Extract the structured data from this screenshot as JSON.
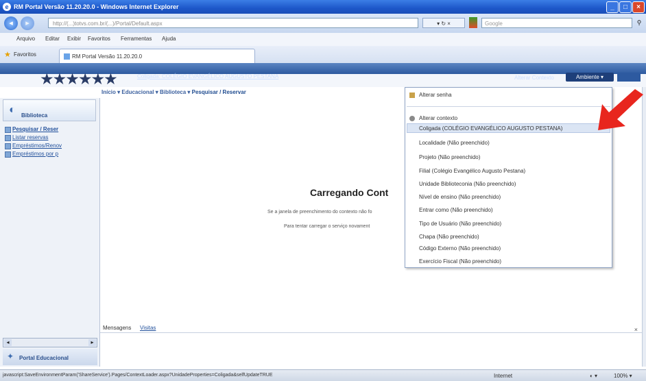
{
  "window": {
    "title": "RM Portal Versão 11.20.20.0 - Windows Internet Explorer",
    "min": "_",
    "max": "□",
    "close": "×"
  },
  "address": {
    "url": "http://(...)totvs.com.br/(...)/Portal/Default.aspx",
    "controls": "▾ ↻ ×",
    "search_placeholder": "Google",
    "search_icon": "search-icon"
  },
  "menu": {
    "items": [
      "Arquivo",
      "Editar",
      "Exibir",
      "Favoritos",
      "Ferramentas",
      "Ajuda"
    ]
  },
  "favorites": {
    "label": "Favoritos",
    "tab_title": "RM Portal Versão 11.20.20.0"
  },
  "portal": {
    "stars": "★★★★★★",
    "context_link": "Coligada: COLÉGIO EVANGÉLICO AUGUSTO PESTANA",
    "user_token": "Alterar Contexto",
    "ambiente_button": "Ambiente ▾",
    "breadcrumb_prefix": "Início ▾  Educacional ▾  Biblioteca ▾ ",
    "breadcrumb_current": "Pesquisar / Reservar"
  },
  "sidebar": {
    "title": "Biblioteca",
    "items": [
      {
        "label": "Pesquisar / Reser",
        "icon": "search-icon"
      },
      {
        "label": "Listar reservas",
        "icon": "list-icon"
      },
      {
        "label": "Empréstimos/Renov",
        "icon": "book-icon"
      },
      {
        "label": "Empréstimos por p",
        "icon": "book-icon"
      }
    ],
    "scroll_left": "◂",
    "scroll_right": "▸",
    "footer": "Portal Educacional"
  },
  "main": {
    "loading_title": "Carregando Cont",
    "loading_line1": "Se a janela de preenchimento do contexto não fo",
    "loading_line2": "Para tentar carregar o serviço novament"
  },
  "messages": {
    "tab1": "Mensagens",
    "tab2": "Visitas",
    "close": "×"
  },
  "dropdown": {
    "change_password": "Alterar senha",
    "change_context": "Alterar contexto",
    "items": [
      "Coligada (COLÉGIO EVANGÉLICO AUGUSTO PESTANA)",
      "Localidade (Não preenchido)",
      "Projeto (Não preenchido)",
      "Filial (Colégio Evangélico Augusto Pestana)",
      "Unidade Biblioteconia (Não preenchido)",
      "Nível de ensino (Não preenchido)",
      "Entrar como (Não preenchido)",
      "Tipo de Usuário (Não preenchido)",
      "Chapa (Não preenchido)",
      "Código Externo (Não preenchido)",
      "Exercício Fiscal (Não preenchido)"
    ],
    "highlighted_index": 0
  },
  "status": {
    "text": "javascript:SaveEnvironmentParam('ShareService').Pages/ContextLoader.aspx?UnidadeProperties=Coligada&selfUpdateTRUE",
    "zone": "Internet",
    "protect": "◐ ▾",
    "zoom": "100% ▾"
  },
  "colors": {
    "accent": "#2d5aa0",
    "arrow": "#e8261e",
    "highlight": "#dbe5f4"
  }
}
